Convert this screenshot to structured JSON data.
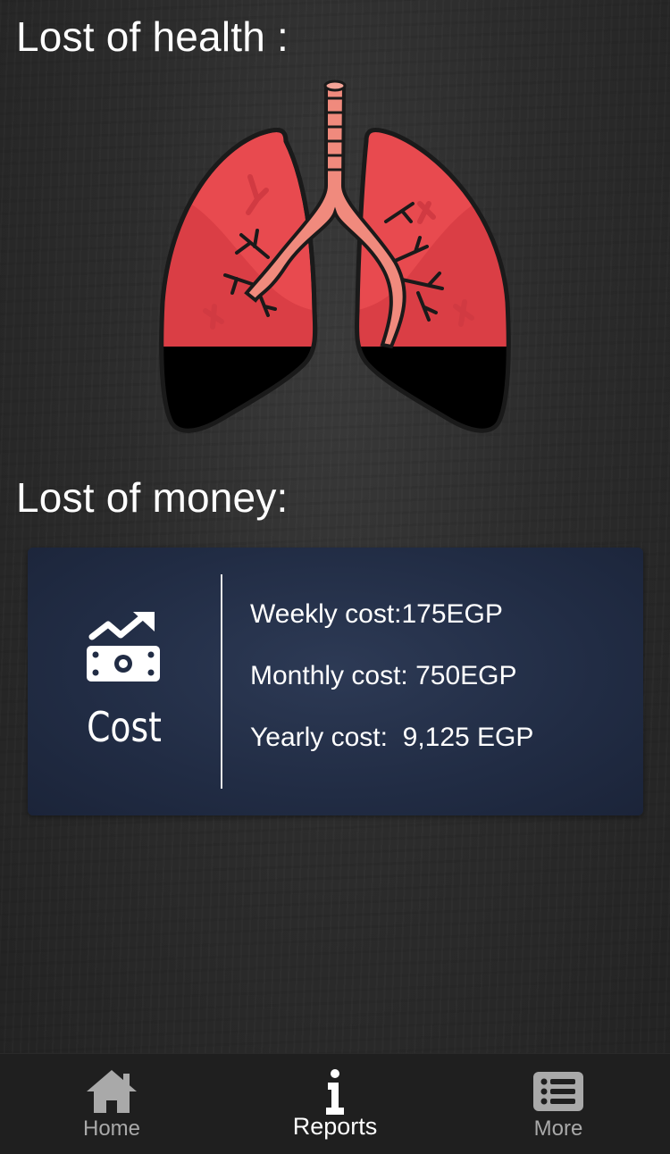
{
  "health": {
    "title": "Lost of health :",
    "illustration": "lungs-icon",
    "lung_color": "#e84a4f",
    "damage_color": "#000000"
  },
  "money": {
    "title": "Lost of money:",
    "card": {
      "icon": "money-growth-icon",
      "label": "Cost",
      "weekly": "Weekly cost:175EGP",
      "monthly": "Monthly cost: 750EGP",
      "yearly": "Yearly cost:  9,125 EGP",
      "background": "#212c44"
    }
  },
  "bottom_nav": {
    "items": [
      {
        "label": "Home",
        "icon": "home-icon",
        "active": false
      },
      {
        "label": "Reports",
        "icon": "info-icon",
        "active": true
      },
      {
        "label": "More",
        "icon": "list-icon",
        "active": false
      }
    ]
  }
}
